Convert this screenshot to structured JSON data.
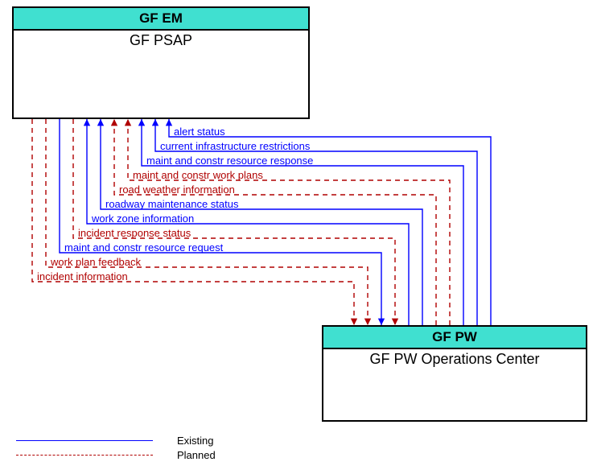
{
  "nodes": {
    "top": {
      "header": "GF EM",
      "body": "GF PSAP"
    },
    "bottom": {
      "header": "GF PW",
      "body": "GF PW Operations Center"
    }
  },
  "flows": [
    {
      "label": "alert status",
      "type": "existing",
      "dir": "to_top"
    },
    {
      "label": "current infrastructure restrictions",
      "type": "existing",
      "dir": "to_top"
    },
    {
      "label": "maint and constr resource response",
      "type": "existing",
      "dir": "to_top"
    },
    {
      "label": "maint and constr work plans",
      "type": "planned",
      "dir": "to_top"
    },
    {
      "label": "road weather information",
      "type": "planned",
      "dir": "to_top"
    },
    {
      "label": "roadway maintenance status",
      "type": "existing",
      "dir": "to_top"
    },
    {
      "label": "work zone information",
      "type": "existing",
      "dir": "to_top"
    },
    {
      "label": "incident response status",
      "type": "planned",
      "dir": "to_bottom"
    },
    {
      "label": "maint and constr resource request",
      "type": "existing",
      "dir": "to_bottom"
    },
    {
      "label": "work plan feedback",
      "type": "planned",
      "dir": "to_bottom"
    },
    {
      "label": "incident information",
      "type": "planned",
      "dir": "to_bottom"
    }
  ],
  "legend": {
    "existing": "Existing",
    "planned": "Planned"
  }
}
